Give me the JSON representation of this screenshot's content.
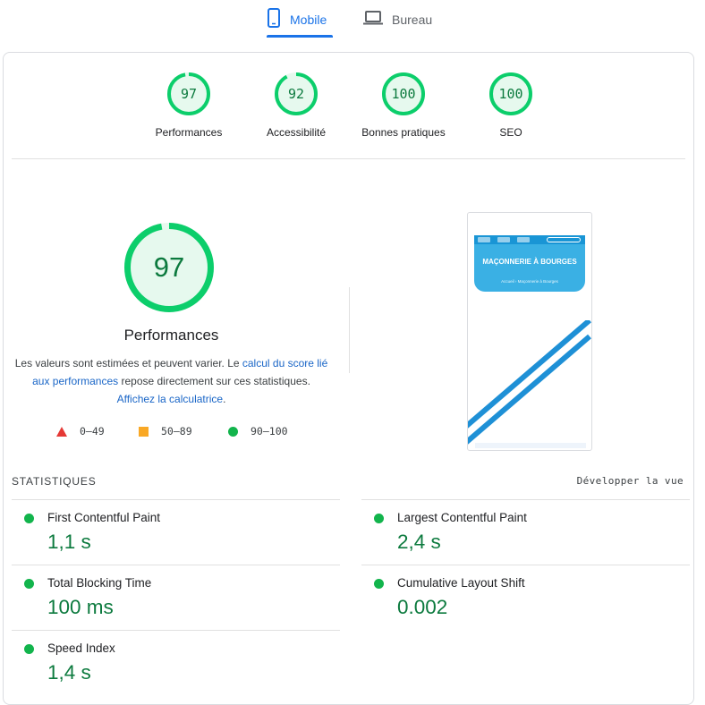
{
  "tabs": {
    "mobile": "Mobile",
    "desktop": "Bureau"
  },
  "categories": [
    {
      "score": 97,
      "label": "Performances"
    },
    {
      "score": 92,
      "label": "Accessibilité"
    },
    {
      "score": 100,
      "label": "Bonnes pratiques"
    },
    {
      "score": 100,
      "label": "SEO"
    }
  ],
  "main": {
    "score": 97,
    "title": "Performances",
    "desc_part1": "Les valeurs sont estimées et peuvent varier. Le ",
    "desc_link1": "calcul du score lié aux performances",
    "desc_part2": " repose directement sur ces statistiques. ",
    "desc_link2": "Affichez la calculatrice",
    "desc_part3": "."
  },
  "legend": {
    "fail": "0–49",
    "average": "50–89",
    "pass": "90–100"
  },
  "preview": {
    "title": "MAÇONNERIE À BOURGES",
    "breadcrumb": "Accueil  ›  Maçonnerie à Bourges"
  },
  "stats": {
    "title": "STATISTIQUES",
    "expand": "Développer la vue",
    "metrics": [
      {
        "name": "First Contentful Paint",
        "value": "1,1 s"
      },
      {
        "name": "Largest Contentful Paint",
        "value": "2,4 s"
      },
      {
        "name": "Total Blocking Time",
        "value": "100 ms"
      },
      {
        "name": "Cumulative Layout Shift",
        "value": "0.002"
      },
      {
        "name": "Speed Index",
        "value": "1,4 s"
      }
    ]
  },
  "colors": {
    "pass": "#0cce6b",
    "pass_text": "#0c7a3e",
    "fail": "#e53935",
    "average": "#f9a825",
    "accent": "#1a73e8"
  }
}
